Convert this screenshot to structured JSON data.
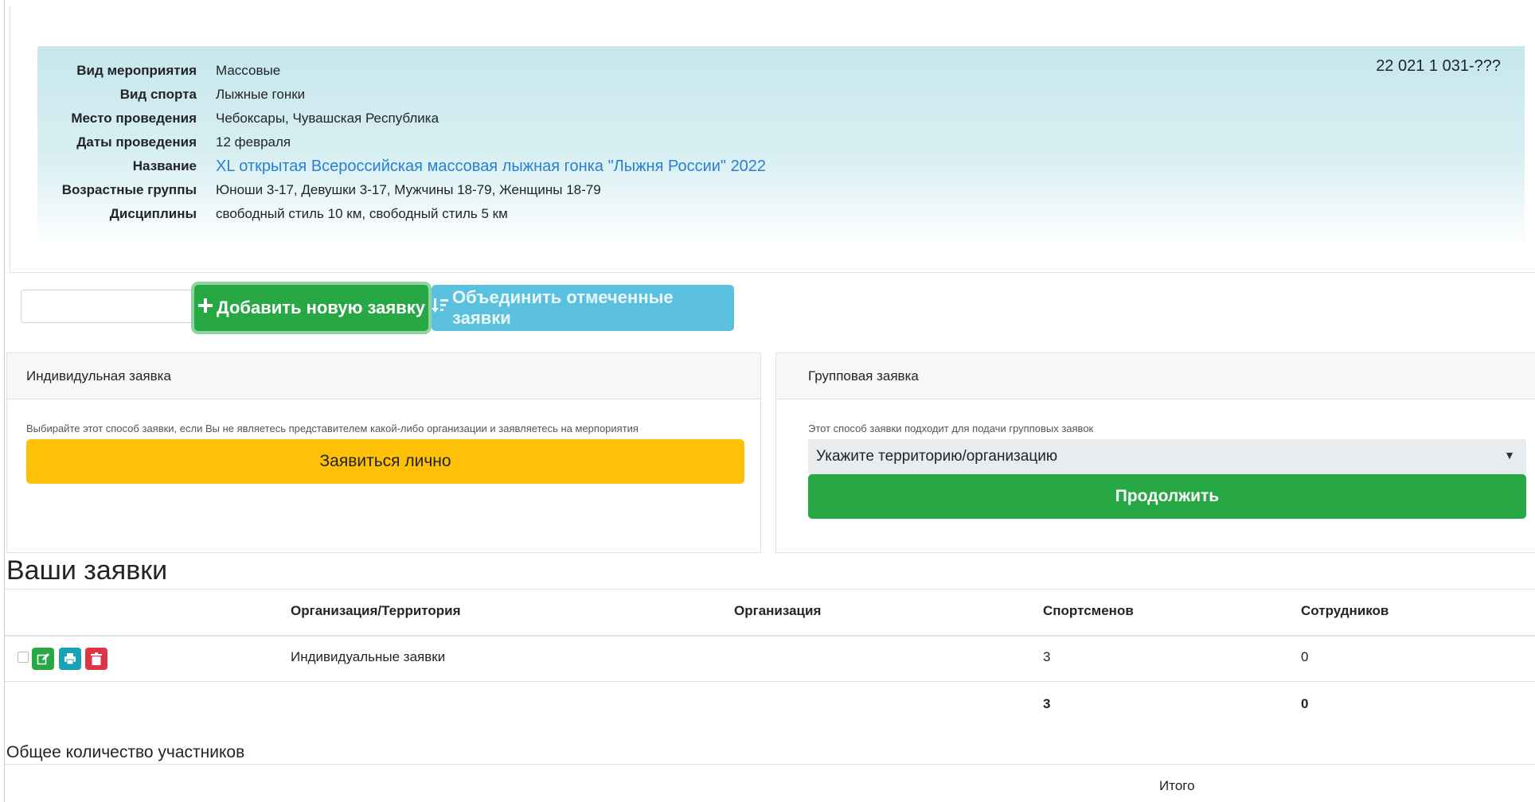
{
  "event": {
    "code": "22 021 1 031-???",
    "rows": [
      {
        "label": "Вид мероприятия",
        "value": "Массовые"
      },
      {
        "label": "Вид спорта",
        "value": "Лыжные гонки"
      },
      {
        "label": "Место проведения",
        "value": "Чебоксары, Чувашская Республика"
      },
      {
        "label": "Даты проведения",
        "value": "12 февраля"
      },
      {
        "label": "Название",
        "value": "XL открытая Всероссийская массовая лыжная гонка \"Лыжня России\" 2022"
      },
      {
        "label": "Возрастные группы",
        "value": "Юноши 3-17, Девушки 3-17, Мужчины 18-79, Женщины 18-79"
      },
      {
        "label": "Дисциплины",
        "value": "свободный стиль 10 км, свободный стиль 5 км"
      }
    ]
  },
  "toolbar": {
    "filter_value": "",
    "add_label": "Добавить новую заявку",
    "merge_label": "Объединить отмеченные заявки"
  },
  "individual": {
    "title": "Индивидульная заявка",
    "hint": "Выбирайте этот способ заявки, если Вы не являетесь представителем какой-либо организации и заявляетесь на мерпориятия",
    "button_label": "Заявиться лично"
  },
  "group": {
    "title": "Групповая заявка",
    "hint": "Этот способ заявки подходит для подачи групповых заявок",
    "select_value": "Укажите территорию/организацию",
    "button_label": "Продолжить"
  },
  "applications": {
    "title": "Ваши заявки",
    "columns": [
      "Организация/Территория",
      "Организация",
      "Спортсменов",
      "Сотрудников"
    ],
    "rows": [
      {
        "org_territory": "Индивидуальные заявки",
        "organization": "",
        "athletes": "3",
        "staff": "0"
      }
    ],
    "totals": {
      "athletes": "3",
      "staff": "0"
    }
  },
  "participants": {
    "title": "Общее количество участников",
    "total_label": "Итого"
  },
  "colors": {
    "success": "#28a745",
    "info": "#5bc0de",
    "warning": "#ffc107",
    "danger": "#dc3545",
    "link": "#2a7fd4"
  }
}
